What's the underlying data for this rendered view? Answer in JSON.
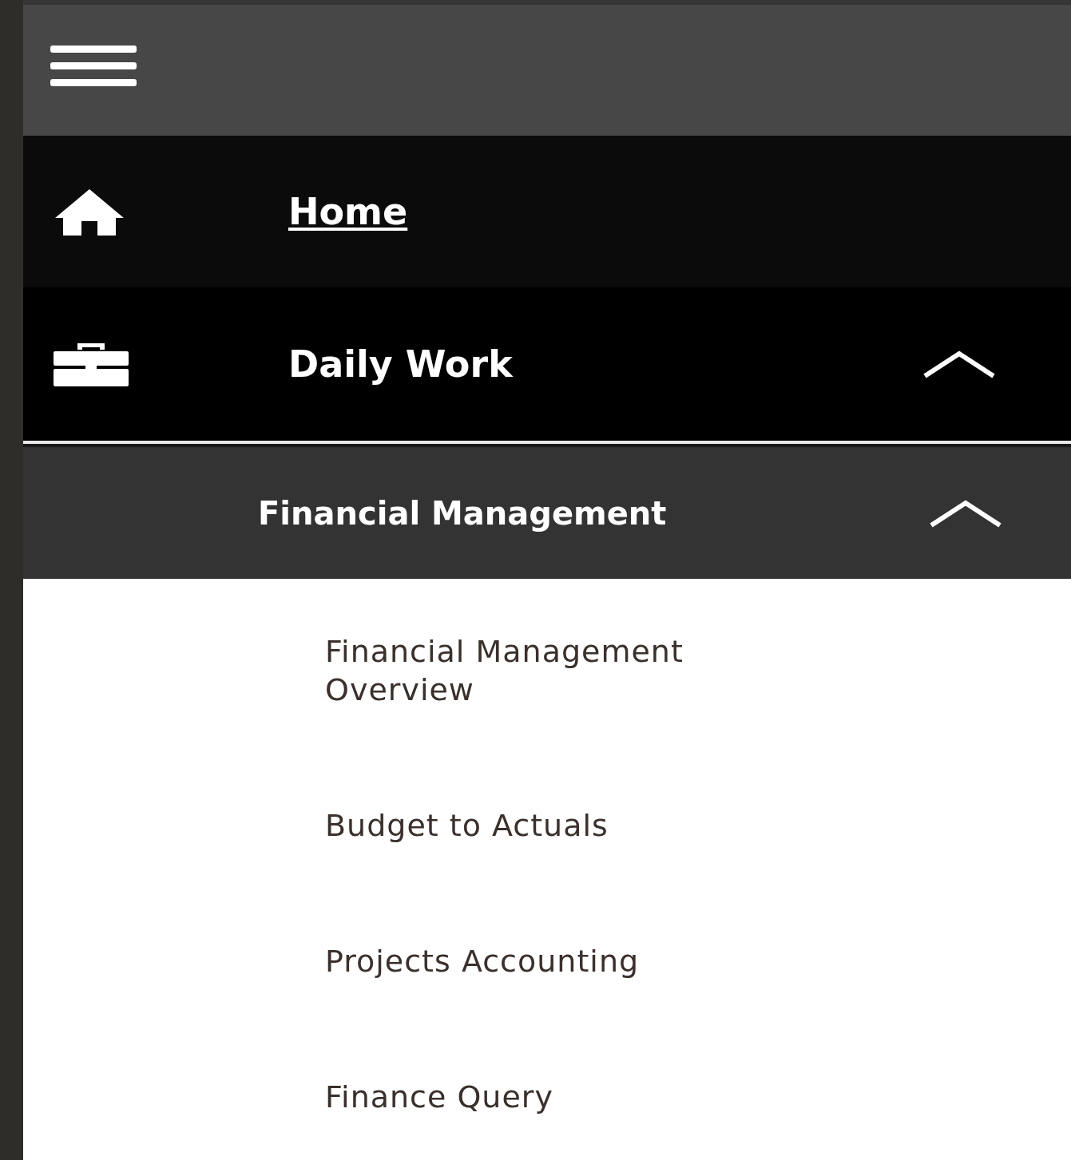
{
  "nav": [
    {
      "kind": "link",
      "label": "Home"
    },
    {
      "kind": "group",
      "label": "Daily Work",
      "expanded": true,
      "children": [
        {
          "label": "Financial Management",
          "expanded": true,
          "children": [
            {
              "label": "Financial Management Overview"
            },
            {
              "label": "Budget to Actuals"
            },
            {
              "label": "Projects Accounting"
            },
            {
              "label": "Finance Query"
            }
          ]
        }
      ]
    }
  ]
}
